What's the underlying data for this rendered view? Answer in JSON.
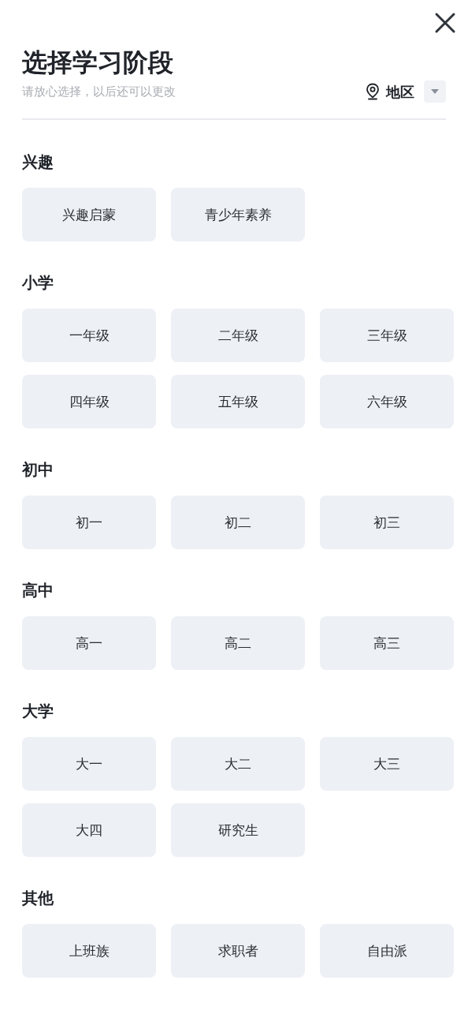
{
  "header": {
    "title": "选择学习阶段",
    "subtitle": "请放心选择，以后还可以更改",
    "region_label": "地区"
  },
  "sections": [
    {
      "title": "兴趣",
      "options": [
        "兴趣启蒙",
        "青少年素养"
      ]
    },
    {
      "title": "小学",
      "options": [
        "一年级",
        "二年级",
        "三年级",
        "四年级",
        "五年级",
        "六年级"
      ]
    },
    {
      "title": "初中",
      "options": [
        "初一",
        "初二",
        "初三"
      ]
    },
    {
      "title": "高中",
      "options": [
        "高一",
        "高二",
        "高三"
      ]
    },
    {
      "title": "大学",
      "options": [
        "大一",
        "大二",
        "大三",
        "大四",
        "研究生"
      ]
    },
    {
      "title": "其他",
      "options": [
        "上班族",
        "求职者",
        "自由派"
      ]
    }
  ]
}
